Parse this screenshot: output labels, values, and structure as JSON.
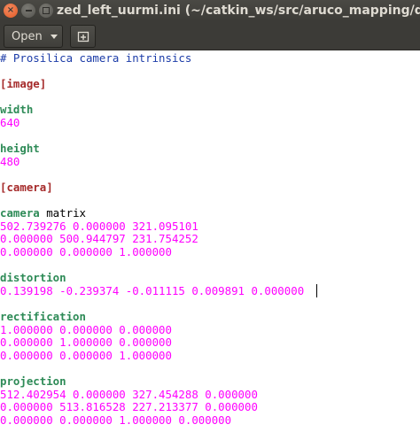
{
  "window": {
    "title": "zed_left_uurmi.ini (~/catkin_ws/src/aruco_mapping/data) - gedit",
    "close_glyph": "×"
  },
  "toolbar": {
    "open_label": "Open",
    "new_tab_icon": "new-tab-icon"
  },
  "editor": {
    "lines": [
      {
        "text": "# Prosilica camera intrinsics",
        "kind": "comment"
      },
      {
        "text": "",
        "kind": "blank"
      },
      {
        "text": "[image]",
        "kind": "section"
      },
      {
        "text": "",
        "kind": "blank"
      },
      {
        "text": "width",
        "kind": "key"
      },
      {
        "text": "640",
        "kind": "value"
      },
      {
        "text": "",
        "kind": "blank"
      },
      {
        "text": "height",
        "kind": "key"
      },
      {
        "text": "480",
        "kind": "value"
      },
      {
        "text": "",
        "kind": "blank"
      },
      {
        "text": "[camera]",
        "kind": "section"
      },
      {
        "text": "",
        "kind": "blank"
      },
      {
        "text": "camera matrix",
        "kind": "key-mixed",
        "key_part": "camera",
        "rest_part": " matrix"
      },
      {
        "text": "502.739276 0.000000 321.095101",
        "kind": "value"
      },
      {
        "text": "0.000000 500.944797 231.754252",
        "kind": "value"
      },
      {
        "text": "0.000000 0.000000 1.000000",
        "kind": "value"
      },
      {
        "text": "",
        "kind": "blank"
      },
      {
        "text": "distortion",
        "kind": "key"
      },
      {
        "text": "0.139198 -0.239374 -0.011115 0.009891 0.000000",
        "kind": "value"
      },
      {
        "text": "",
        "kind": "blank"
      },
      {
        "text": "rectification",
        "kind": "key"
      },
      {
        "text": "1.000000 0.000000 0.000000",
        "kind": "value"
      },
      {
        "text": "0.000000 1.000000 0.000000",
        "kind": "value"
      },
      {
        "text": "0.000000 0.000000 1.000000",
        "kind": "value"
      },
      {
        "text": "",
        "kind": "blank"
      },
      {
        "text": "projection",
        "kind": "key"
      },
      {
        "text": "512.402954 0.000000 327.454288 0.000000",
        "kind": "value"
      },
      {
        "text": "0.000000 513.816528 227.213377 0.000000",
        "kind": "value"
      },
      {
        "text": "0.000000 0.000000 1.000000 0.000000",
        "kind": "value"
      }
    ]
  },
  "colors": {
    "comment": "#1c3ca8",
    "section": "#a52a2a",
    "key": "#2e8b57",
    "value": "#ff00ff",
    "titlebar": "#3c3b37"
  }
}
